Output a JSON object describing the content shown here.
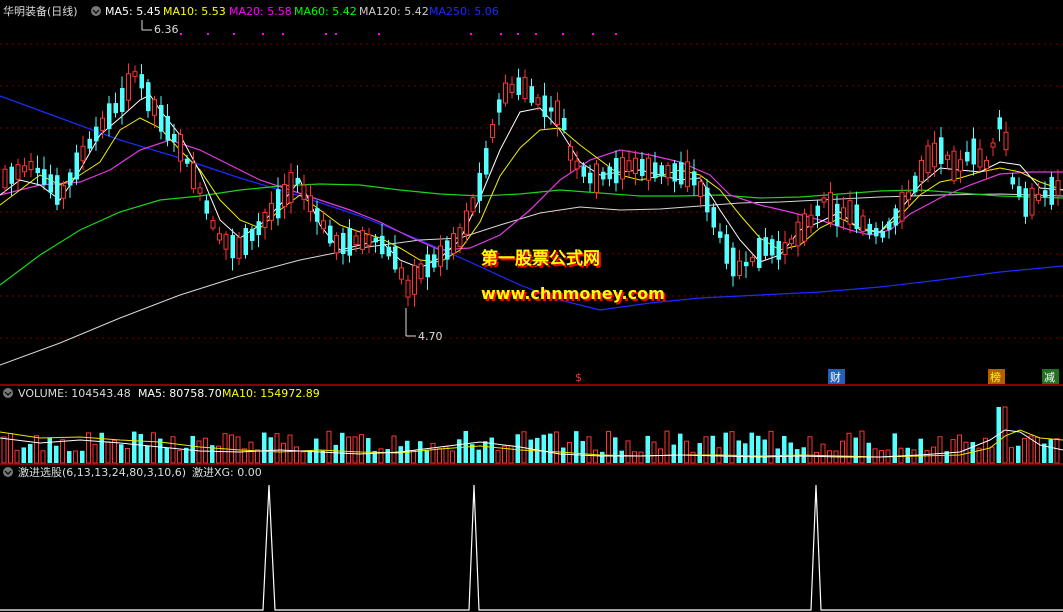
{
  "main_panel": {
    "stock_name": "华明装备",
    "period_label": "(日线)",
    "ma_indicators": [
      {
        "label": "MA5: 5.45",
        "color": "#ffffff"
      },
      {
        "label": "MA10: 5.53",
        "color": "#ffff00"
      },
      {
        "label": "MA20: 5.58",
        "color": "#ff00ff"
      },
      {
        "label": "MA60: 5.42",
        "color": "#00ff00"
      },
      {
        "label": "MA120: 5.42",
        "color": "#cccccc"
      },
      {
        "label": "MA250: 5.06",
        "color": "#0000ff"
      }
    ],
    "high_label": "6.36",
    "low_label": "4.70",
    "markers": [
      "$",
      "财",
      "榜",
      "减"
    ],
    "watermark_title": "第一股票公式网",
    "watermark_url": "www.chnmoney.com"
  },
  "volume_panel": {
    "title": "VOLUME: 104543.48",
    "ma5": "MA5: 80758.70",
    "ma10": "MA10: 154972.89"
  },
  "indicator_panel": {
    "title": "激进选股(6,13,13,24,80,3,10,6)",
    "xg": "激进XG: 0.00"
  },
  "colors": {
    "up": "#ff3232",
    "down": "#54ffff",
    "grid": "#7a0000",
    "separator": "#b40000",
    "watermark_shadow": "#ff0000",
    "watermark_fill": "#ffff00"
  },
  "chart_data": {
    "type": "candlestick",
    "price_range": [
      4.5,
      6.5
    ],
    "high": 6.36,
    "low": 4.7,
    "signals": 3
  }
}
